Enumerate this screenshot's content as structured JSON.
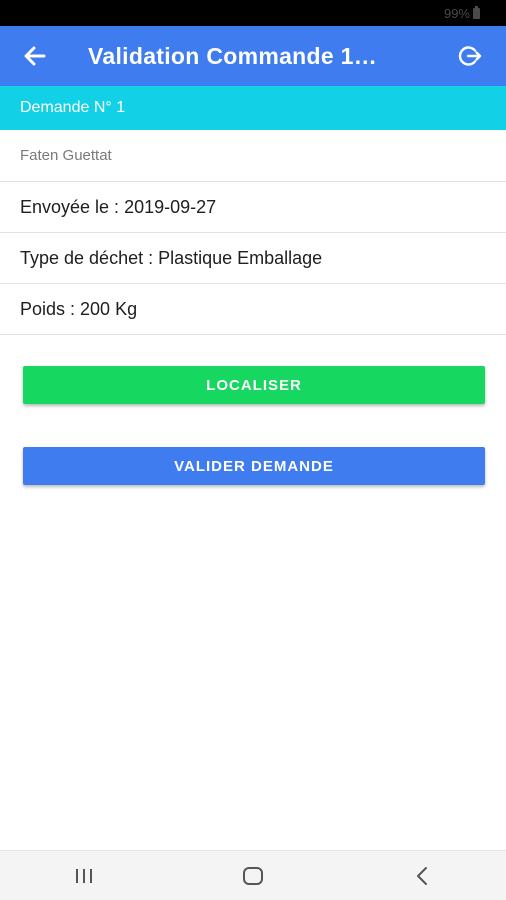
{
  "status_bar": {
    "battery_text": "99%",
    "battery_icon": "battery-icon"
  },
  "app_bar": {
    "title": "Validation Commande 1…",
    "back_icon": "arrow-left-icon",
    "logout_icon": "logout-icon",
    "color": "#3f7cf0"
  },
  "sub_header": {
    "label": "Demande N° 1",
    "color": "#12d1e6"
  },
  "details": {
    "name": "Faten Guettat",
    "sent_date": "Envoyée le : 2019-09-27",
    "waste_type": "Type de déchet : Plastique Emballage",
    "weight": "Poids : 200 Kg"
  },
  "buttons": {
    "localiser": {
      "label": "LOCALISER",
      "color": "#16d860"
    },
    "valider": {
      "label": "VALIDER DEMANDE",
      "color": "#3f7cf0"
    }
  },
  "nav_bar": {
    "recents_icon": "recents-icon",
    "home_icon": "home-icon",
    "back_icon": "back-chevron-icon"
  }
}
